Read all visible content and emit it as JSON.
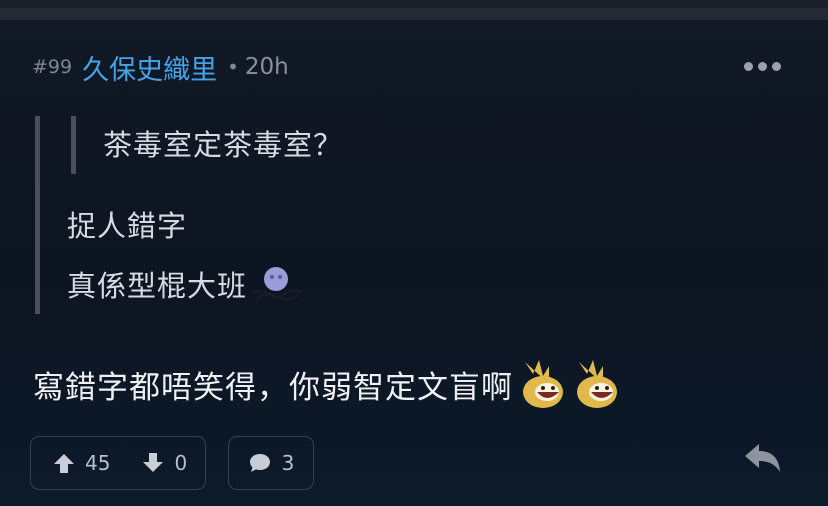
{
  "post": {
    "floor": "#99",
    "username": "久保史織里",
    "separator": "•",
    "time": "20h",
    "quote_inner": "茶毒室定茶毒室？",
    "quote_line1": "捉人錯字",
    "quote_line2": "真係型棍大班",
    "reply_text": "寫錯字都唔笑得，你弱智定文盲啊"
  },
  "actions": {
    "upvotes": "45",
    "downvotes": "0",
    "comments": "3"
  },
  "icons": {
    "more": "more-options-icon",
    "upvote": "arrow-up-icon",
    "downvote": "arrow-down-icon",
    "comments": "comment-bubble-icon",
    "reply": "reply-arrow-icon",
    "ghost": "ghost-emoji-icon",
    "laugh": "laughing-emoji-icon"
  },
  "colors": {
    "background": "#0f1624",
    "username": "#44a4e8",
    "muted_text": "#7d8593",
    "body_text": "#e6e9ee"
  }
}
